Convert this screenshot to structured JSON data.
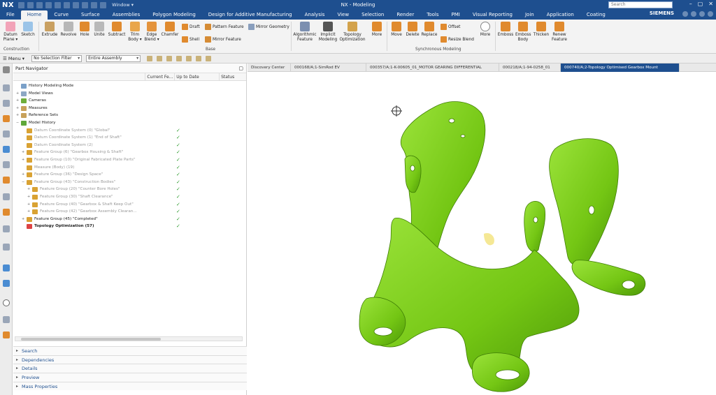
{
  "titlebar": {
    "logo": "NX",
    "window_menu": "Window ▾",
    "title": "NX - Modeling"
  },
  "menubar": {
    "tabs": [
      "File",
      "Home",
      "Curve",
      "Surface",
      "Assemblies",
      "Polygon Modeling",
      "Design for Additive Manufacturing",
      "Analysis",
      "View",
      "Selection",
      "Render",
      "Tools",
      "PMI",
      "Visual Reporting",
      "Join",
      "Application",
      "Coating"
    ],
    "active": "Home",
    "search_placeholder": "Search",
    "brand": "SIEMENS"
  },
  "ribbon": {
    "construction": {
      "datum_plane": "Datum Plane ▾",
      "sketch": "Sketch",
      "group": "Construction"
    },
    "base": {
      "extrude": "Extrude",
      "revolve": "Revolve",
      "hole": "Hole",
      "unite": "Unite",
      "subtract": "Subtract",
      "trim_body": "Trim Body ▾",
      "edge_blend": "Edge Blend ▾",
      "chamfer": "Chamfer",
      "draft": "Draft",
      "shell": "Shell",
      "pattern_feature": "Pattern Feature",
      "mirror_feature": "Mirror Feature",
      "mirror_geometry": "Mirror Geometry",
      "group": "Base"
    },
    "algorithmic_feature": "Algorithmic Feature",
    "implicit_modeling": "Implicit Modeling",
    "topology_optimization": "Topology Optimization",
    "more1": "More",
    "sync": {
      "move": "Move",
      "delete": "Delete",
      "replace": "Replace",
      "offset": "Offset",
      "resize_blend": "Resize Blend",
      "more": "More",
      "group": "Synchronous Modeling"
    },
    "emboss": "Emboss",
    "emboss_body": "Emboss Body",
    "thicken": "Thicken",
    "renew_feature": "Renew Feature"
  },
  "seltoolbar": {
    "menu": "☰ Menu ▾",
    "filter": "No Selection Filter",
    "scope": "Entire Assembly"
  },
  "navigator": {
    "title": "Part Navigator",
    "columns": [
      "",
      "Current Fe...",
      "Up to Date",
      "Status"
    ],
    "rows": [
      {
        "label": "History Modeling Mode",
        "style": "normal",
        "indent": 0,
        "exp": "",
        "check": ""
      },
      {
        "label": "Model Views",
        "style": "normal",
        "indent": 0,
        "exp": "+",
        "check": ""
      },
      {
        "label": "Cameras",
        "style": "normal",
        "indent": 0,
        "exp": "+",
        "check": ""
      },
      {
        "label": "Measures",
        "style": "normal",
        "indent": 0,
        "exp": "+",
        "check": ""
      },
      {
        "label": "Reference Sets",
        "style": "normal",
        "indent": 0,
        "exp": "+",
        "check": ""
      },
      {
        "label": "Model History",
        "style": "normal",
        "indent": 0,
        "exp": "−",
        "check": ""
      },
      {
        "label": "Datum Coordinate System (0) \"Global\"",
        "style": "dim",
        "indent": 1,
        "exp": "",
        "check": "✓"
      },
      {
        "label": "Datum Coordinate System (1) \"End of Shaft\"",
        "style": "dim",
        "indent": 1,
        "exp": "",
        "check": "✓"
      },
      {
        "label": "Datum Coordinate System (2)",
        "style": "dim",
        "indent": 1,
        "exp": "",
        "check": "✓"
      },
      {
        "label": "Feature Group (6) \"Gearbox Housing & Shaft\"",
        "style": "dim",
        "indent": 1,
        "exp": "+",
        "check": "✓"
      },
      {
        "label": "Feature Group (10) \"Original Fabricated Plate Parts\"",
        "style": "dim",
        "indent": 1,
        "exp": "+",
        "check": "✓"
      },
      {
        "label": "Measure (Body) (19)",
        "style": "dim",
        "indent": 1,
        "exp": "",
        "check": "✓"
      },
      {
        "label": "Feature Group (36) \"Design Space\"",
        "style": "dim",
        "indent": 1,
        "exp": "+",
        "check": "✓"
      },
      {
        "label": "Feature Group (43) \"Construction Bodies\"",
        "style": "dim",
        "indent": 1,
        "exp": "−",
        "check": "✓"
      },
      {
        "label": "Feature Group (20) \"Counter Bore Holes\"",
        "style": "dim",
        "indent": 2,
        "exp": "+",
        "check": "✓"
      },
      {
        "label": "Feature Group (30) \"Shaft Clearance\"",
        "style": "dim",
        "indent": 2,
        "exp": "+",
        "check": "✓"
      },
      {
        "label": "Feature Group (40) \"Gearbox & Shaft Keep Out\"",
        "style": "dim",
        "indent": 2,
        "exp": "+",
        "check": "✓"
      },
      {
        "label": "Feature Group (42) \"Gearbox Assembly Clearan...",
        "style": "dim",
        "indent": 2,
        "exp": "+",
        "check": "✓"
      },
      {
        "label": "Feature Group (45) \"Completed\"",
        "style": "normal",
        "indent": 1,
        "exp": "+",
        "check": "✓"
      },
      {
        "label": "Topology Optimization (57)",
        "style": "bold",
        "indent": 1,
        "exp": "",
        "check": "✓"
      }
    ],
    "panels": [
      "Search",
      "Dependencies",
      "Details",
      "Preview",
      "Mass Properties"
    ]
  },
  "doc_tabs": [
    {
      "label": "Discovery Center",
      "active": false
    },
    {
      "label": "000168/A;1-SimRod EV",
      "active": false
    },
    {
      "label": "000357/A;1-K-00605_01_MOTOR GEARING DIFFERENTIAL",
      "active": false
    },
    {
      "label": "000218/A;1-94-0258_01",
      "active": false
    },
    {
      "label": "000740/A;2-Topology Optimised Gearbox Mount",
      "active": true
    }
  ],
  "colors": {
    "title_blue": "#1e4f8f",
    "part_green": "#7fd11b",
    "check_green": "#2e9b2e"
  }
}
